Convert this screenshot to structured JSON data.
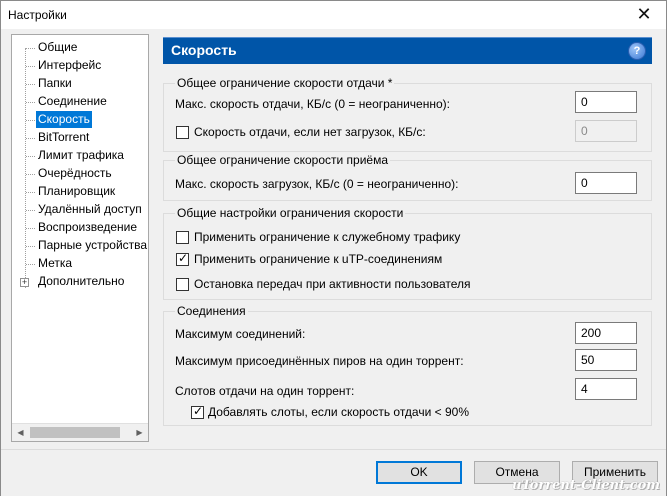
{
  "window": {
    "title": "Настройки",
    "close_glyph": "✕"
  },
  "tree": {
    "items": [
      {
        "label": "Общие"
      },
      {
        "label": "Интерфейс"
      },
      {
        "label": "Папки"
      },
      {
        "label": "Соединение"
      },
      {
        "label": "Скорость",
        "selected": true
      },
      {
        "label": "BitTorrent"
      },
      {
        "label": "Лимит трафика"
      },
      {
        "label": "Очерёдность"
      },
      {
        "label": "Планировщик"
      },
      {
        "label": "Удалённый доступ"
      },
      {
        "label": "Воспроизведение"
      },
      {
        "label": "Парные устройства"
      },
      {
        "label": "Метка"
      },
      {
        "label": "Дополнительно",
        "expandable": true
      }
    ],
    "expander_glyph": "+",
    "scroll_left": "◀",
    "scroll_right": "▶"
  },
  "panel": {
    "title": "Скорость",
    "help_glyph": "?"
  },
  "upload": {
    "title": "Общее ограничение скорости отдачи *",
    "max_label": "Макс. скорость отдачи, КБ/с (0 = неограниченно):",
    "max_value": "0",
    "no_dl_label": "Скорость отдачи, если нет загрузок, КБ/с:",
    "no_dl_checked": false,
    "no_dl_value": "0"
  },
  "download": {
    "title": "Общее ограничение скорости приёма",
    "max_label": "Макс. скорость загрузок, КБ/с (0 = неограниченно):",
    "max_value": "0"
  },
  "general": {
    "title": "Общие настройки ограничения скорости",
    "overhead_label": "Применить ограничение к служебному трафику",
    "overhead_checked": false,
    "utp_label": "Применить ограничение к uTP-соединениям",
    "utp_checked": true,
    "stop_label": "Остановка передач при активности пользователя",
    "stop_checked": false
  },
  "connections": {
    "title": "Соединения",
    "max_conn_label": "Максимум соединений:",
    "max_conn_value": "200",
    "max_peers_label": "Максимум присоединённых пиров на один торрент:",
    "max_peers_value": "50",
    "slots_label": "Слотов отдачи на один торрент:",
    "slots_value": "4",
    "extra_slots_label": "Добавлять слоты, если скорость отдачи < 90%",
    "extra_slots_checked": true
  },
  "buttons": {
    "ok": "OK",
    "cancel": "Отмена",
    "apply": "Применить"
  },
  "watermark": "uTorrent-Client.com",
  "colors": {
    "header": "#0055a8",
    "selection": "#0078d7"
  }
}
